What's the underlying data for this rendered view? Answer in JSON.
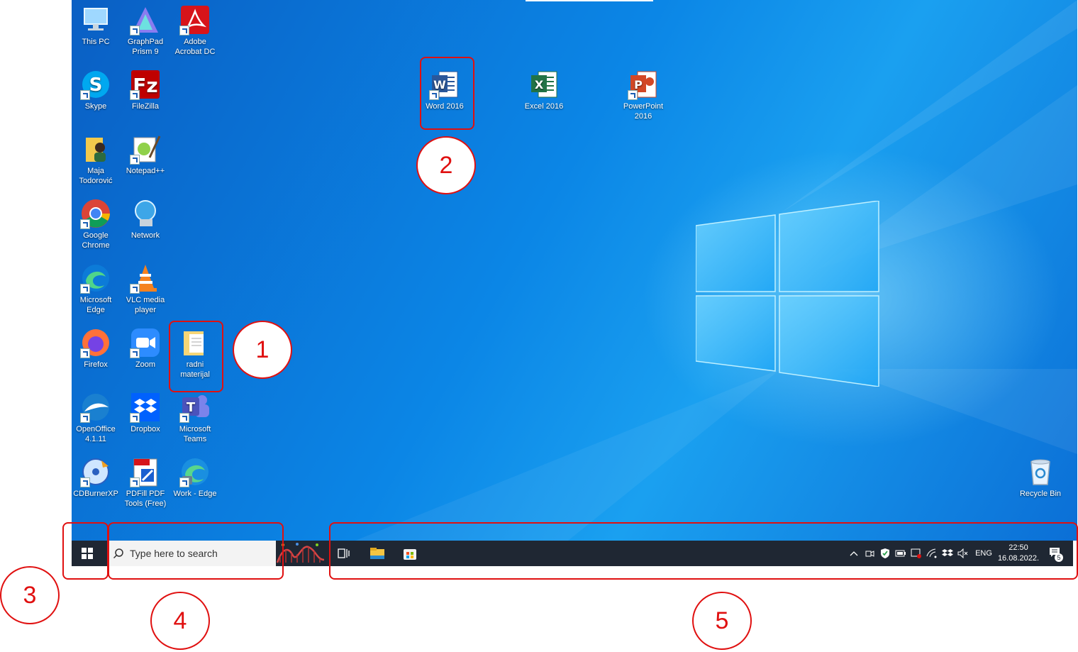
{
  "desktop_icons": [
    {
      "label": "This PC",
      "icon": "this-pc-icon"
    },
    {
      "label": "GraphPad Prism 9",
      "icon": "graphpad-icon"
    },
    {
      "label": "Adobe Acrobat DC",
      "icon": "acrobat-icon"
    },
    {
      "label": "Skype",
      "icon": "skype-icon"
    },
    {
      "label": "FileZilla",
      "icon": "filezilla-icon"
    },
    {
      "label": "Maja Todorović",
      "icon": "user-folder-icon"
    },
    {
      "label": "Notepad++",
      "icon": "notepadpp-icon"
    },
    {
      "label": "Google Chrome",
      "icon": "chrome-icon"
    },
    {
      "label": "Network",
      "icon": "network-icon"
    },
    {
      "label": "Microsoft Edge",
      "icon": "edge-icon"
    },
    {
      "label": "VLC media player",
      "icon": "vlc-icon"
    },
    {
      "label": "Firefox",
      "icon": "firefox-icon"
    },
    {
      "label": "Zoom",
      "icon": "zoom-icon"
    },
    {
      "label": "radni materijal",
      "icon": "folder-icon"
    },
    {
      "label": "OpenOffice 4.1.11",
      "icon": "openoffice-icon"
    },
    {
      "label": "Dropbox",
      "icon": "dropbox-icon"
    },
    {
      "label": "Microsoft Teams",
      "icon": "teams-icon"
    },
    {
      "label": "CDBurnerXP",
      "icon": "cdburner-icon"
    },
    {
      "label": "PDFill PDF Tools (Free)",
      "icon": "pdfill-icon"
    },
    {
      "label": "Work - Edge",
      "icon": "edge-work-icon"
    },
    {
      "label": "Word 2016",
      "icon": "word-icon"
    },
    {
      "label": "Excel 2016",
      "icon": "excel-icon"
    },
    {
      "label": "PowerPoint 2016",
      "icon": "powerpoint-icon"
    },
    {
      "label": "Recycle Bin",
      "icon": "recycle-bin-icon"
    }
  ],
  "taskbar": {
    "search_placeholder": "Type here to search",
    "language": "ENG",
    "time": "22:50",
    "date": "16.08.2022.",
    "notification_count": "5"
  },
  "annotations": [
    "1",
    "2",
    "3",
    "4",
    "5"
  ],
  "colors": {
    "annotation": "#e01010",
    "taskbar": "#1f2733",
    "desktop": "#0b86e6"
  }
}
